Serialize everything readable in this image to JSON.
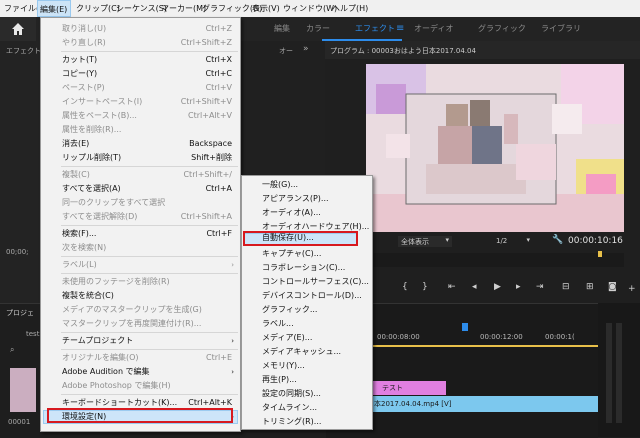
{
  "menubar": {
    "items": [
      "ファイル(F)",
      "編集(E)",
      "クリップ(C)",
      "シーケンス(S)",
      "マーカー(M)",
      "グラフィック(G)",
      "表示(V)",
      "ウィンドウ(W)",
      "ヘルプ(H)"
    ]
  },
  "workspace": {
    "tabs": [
      "編集",
      "カラー",
      "エフェクト",
      "オーディオ",
      "グラフィック",
      "ライブラリ"
    ],
    "active_menu_icon": "≡"
  },
  "left_panel": {
    "title": "エフェクト",
    "timecode": "00;00;",
    "project_label": "プロジェ",
    "project_file": "test",
    "project_clip": "00001"
  },
  "source_panel": {
    "tab_label": "オー"
  },
  "program": {
    "title": "プログラム : 00003おはよう日本2017.04.04",
    "fit_label": "全体表示",
    "resolution": "1/2",
    "timecode": "00:00:10:16"
  },
  "timeline": {
    "ruler": [
      "00:00:08:00",
      "00:00:12:00",
      "00:00:1("
    ],
    "clip_text": "テスト",
    "clip_video": "本2017.04.04.mp4 [V]"
  },
  "edit_menu": {
    "items": [
      {
        "label": "取り消し(U)",
        "shortcut": "Ctrl+Z",
        "enabled": false
      },
      {
        "label": "やり直し(R)",
        "shortcut": "Ctrl+Shift+Z",
        "enabled": false
      },
      {
        "label": "カット(T)",
        "shortcut": "Ctrl+X",
        "enabled": true
      },
      {
        "label": "コピー(Y)",
        "shortcut": "Ctrl+C",
        "enabled": true
      },
      {
        "label": "ペースト(P)",
        "shortcut": "Ctrl+V",
        "enabled": false
      },
      {
        "label": "インサートペースト(I)",
        "shortcut": "Ctrl+Shift+V",
        "enabled": false
      },
      {
        "label": "属性をペースト(B)...",
        "shortcut": "Ctrl+Alt+V",
        "enabled": false
      },
      {
        "label": "属性を削除(R)...",
        "shortcut": "",
        "enabled": false
      },
      {
        "label": "消去(E)",
        "shortcut": "Backspace",
        "enabled": true
      },
      {
        "label": "リップル削除(T)",
        "shortcut": "Shift+削除",
        "enabled": true
      },
      {
        "label": "複製(C)",
        "shortcut": "Ctrl+Shift+/",
        "enabled": false
      },
      {
        "label": "すべてを選択(A)",
        "shortcut": "Ctrl+A",
        "enabled": true
      },
      {
        "label": "同一のクリップをすべて選択",
        "shortcut": "",
        "enabled": false
      },
      {
        "label": "すべてを選択解除(D)",
        "shortcut": "Ctrl+Shift+A",
        "enabled": false
      },
      {
        "label": "検索(F)...",
        "shortcut": "Ctrl+F",
        "enabled": true
      },
      {
        "label": "次を検索(N)",
        "shortcut": "",
        "enabled": false
      },
      {
        "label": "ラベル(L)",
        "shortcut": "",
        "enabled": false
      },
      {
        "label": "未使用のフッテージを削除(R)",
        "shortcut": "",
        "enabled": false
      },
      {
        "label": "複製を統合(C)",
        "shortcut": "",
        "enabled": true
      },
      {
        "label": "メディアのマスタークリップを生成(G)",
        "shortcut": "",
        "enabled": false
      },
      {
        "label": "マスタークリップを再度関連付け(R)...",
        "shortcut": "",
        "enabled": false
      },
      {
        "label": "チームプロジェクト",
        "shortcut": "",
        "enabled": true
      },
      {
        "label": "オリジナルを編集(O)",
        "shortcut": "Ctrl+E",
        "enabled": false
      },
      {
        "label": "Adobe Audition で編集",
        "shortcut": "",
        "enabled": true
      },
      {
        "label": "Adobe Photoshop で編集(H)",
        "shortcut": "",
        "enabled": false
      },
      {
        "label": "キーボードショートカット(K)...",
        "shortcut": "Ctrl+Alt+K",
        "enabled": true
      },
      {
        "label": "環境設定(N)",
        "shortcut": "",
        "enabled": true
      }
    ]
  },
  "prefs_menu": {
    "items": [
      "一般(G)...",
      "アピアランス(P)...",
      "オーディオ(A)...",
      "オーディオハードウェア(H)...",
      "自動保存(U)...",
      "キャプチャ(C)...",
      "コラボレーション(C)...",
      "コントロールサーフェス(C)...",
      "デバイスコントロール(D)...",
      "グラフィック...",
      "ラベル...",
      "メディア(E)...",
      "メディアキャッシュ...",
      "メモリ(Y)...",
      "再生(P)...",
      "設定の同期(S)...",
      "タイムライン...",
      "トリミング(R)..."
    ]
  },
  "colors": {
    "accent": "#2d8ceb",
    "highlight_box": "#d7191f",
    "clip_pink": "#e07fe0",
    "clip_blue": "#7cc8ee"
  }
}
